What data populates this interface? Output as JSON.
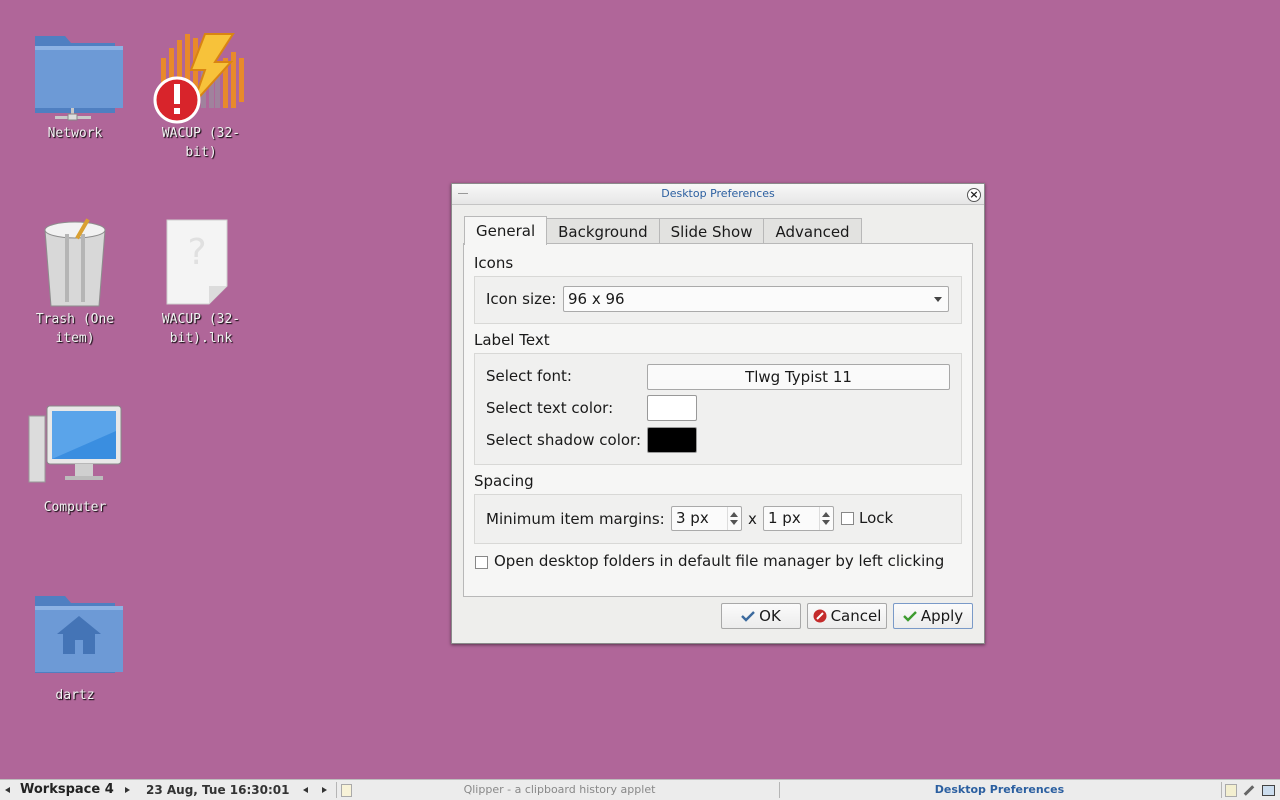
{
  "desktop": {
    "icons": [
      {
        "label": "Network"
      },
      {
        "label": "WACUP (32-bit)"
      },
      {
        "label": "Trash (One item)"
      },
      {
        "label": "WACUP (32-bit).lnk"
      },
      {
        "label": "Computer"
      },
      {
        "label": "dartz"
      }
    ]
  },
  "dialog": {
    "title": "Desktop Preferences",
    "tabs": [
      "General",
      "Background",
      "Slide Show",
      "Advanced"
    ],
    "active_tab": "General",
    "icons_section": {
      "title": "Icons",
      "icon_size_label": "Icon size:",
      "icon_size_value": "96 x 96"
    },
    "label_text_section": {
      "title": "Label Text",
      "select_font_label": "Select font:",
      "font_value": "Tlwg Typist 11",
      "text_color_label": "Select text color:",
      "text_color": "#ffffff",
      "shadow_color_label": "Select shadow color:",
      "shadow_color": "#000000"
    },
    "spacing_section": {
      "title": "Spacing",
      "margins_label": "Minimum item margins:",
      "margin_x": "3 px",
      "times": "x",
      "margin_y": "1 px",
      "lock_label": "Lock",
      "lock_checked": false
    },
    "open_folders_label": "Open desktop folders in default file manager by left clicking",
    "open_folders_checked": false,
    "buttons": {
      "ok": "OK",
      "cancel": "Cancel",
      "apply": "Apply"
    }
  },
  "taskbar": {
    "workspace": "Workspace 4",
    "clock": "23 Aug, Tue 16:30:01",
    "task_clipboard": "Qlipper - a clipboard history applet",
    "task_active": "Desktop Preferences"
  },
  "colors": {
    "desktop_bg": "#b06699",
    "title_text": "#2b5fa0"
  }
}
